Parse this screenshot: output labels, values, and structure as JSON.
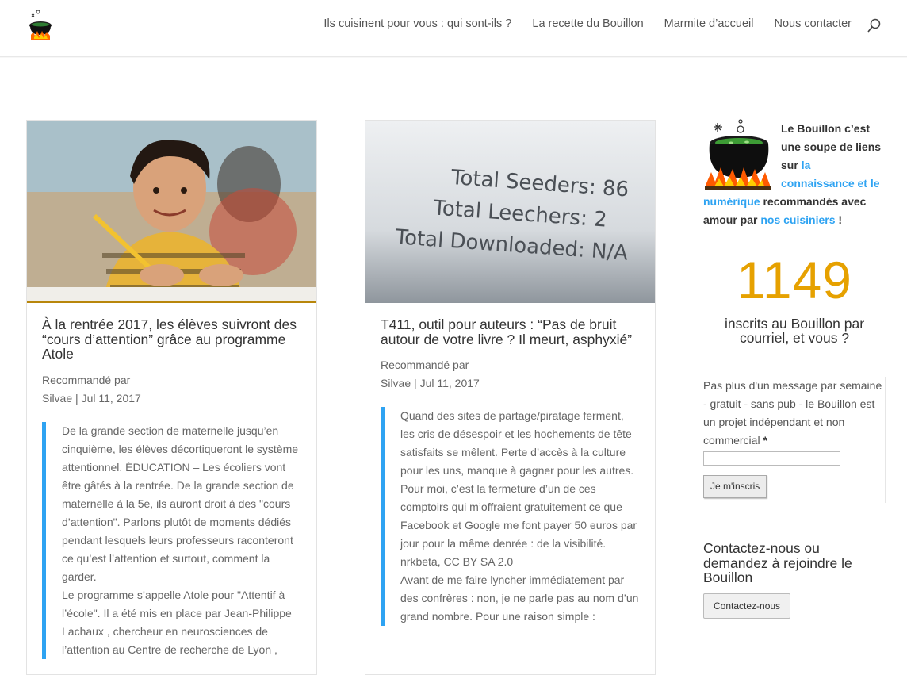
{
  "nav": {
    "items": [
      "Ils cuisinent pour vous : qui sont-ils ?",
      "La recette du Bouillon",
      "Marmite d’accueil",
      "Nous contacter"
    ]
  },
  "posts": [
    {
      "title": "À la rentrée 2017, les élèves suivront des “cours d’attention” grâce au programme Atole",
      "recommended": "Recommandé par",
      "author": "Silvae",
      "separator": "|",
      "date": "Jul 11, 2017",
      "excerpt": [
        "De la grande section de maternelle jusqu’en cinquième, les élèves décortiqueront le système attentionnel. ÉDUCATION – Les écoliers vont être gâtés à la rentrée. De la grande section de maternelle à la 5e, ils auront droit à des \"cours d’attention\". Parlons plutôt de moments dédiés pendant lesquels leurs professeurs raconteront ce qu’est l’attention et surtout, comment la garder.",
        "Le programme s’appelle Atole pour \"Attentif à l’école\". Il a été mis en place par Jean-Philippe Lachaux , chercheur en neurosciences de l’attention au Centre de recherche de Lyon ,"
      ]
    },
    {
      "title": "T411, outil pour auteurs : “Pas de bruit autour de votre livre ? Il meurt, asphyxié”",
      "recommended": "Recommandé par",
      "author": "Silvae",
      "separator": "|",
      "date": "Jul 11, 2017",
      "image_text": [
        "Total Seeders: 86",
        "Total Leechers: 2",
        "Total Downloaded: N/A"
      ],
      "excerpt": [
        "Quand des sites de partage/piratage ferment, les cris de désespoir et les hochements de tête satisfaits se mêlent. Perte d’accès à la culture pour les uns, manque à gagner pour les autres. Pour moi, c’est la fermeture d’un de ces comptoirs qui m’offraient gratuitement ce que Facebook et Google me font payer 50 euros par jour pour la même denrée : de la visibilité.",
        "nrkbeta, CC BY SA 2.0",
        "Avant de me faire lyncher immédiatement par des confrères : non, je ne parle pas au nom d’un grand nombre. Pour une raison simple :"
      ]
    }
  ],
  "sidebar": {
    "intro_1": "Le Bouillon c’est une soupe de liens sur ",
    "intro_link1": "la connaissance et le numérique",
    "intro_2": " recommandés avec amour par ",
    "intro_link2": "nos cuisiniers",
    "intro_3": " !",
    "subscriber_count": "1149",
    "subscriber_label": "inscrits au Bouillon par courriel, et vous ?",
    "form_text": "Pas plus d'un message par semaine - gratuit - sans pub - le Bouillon est un projet indépendant et non commercial",
    "required_mark": "*",
    "subscribe_button": "Je m'inscris",
    "contact_title": "Contactez-nous ou demandez à rejoindre le Bouillon",
    "contact_button": "Contactez-nous"
  },
  "colors": {
    "accent": "#2ea3f2",
    "counter": "#e6a100"
  },
  "icons": {
    "search": "search-icon",
    "logo": "cauldron-logo"
  }
}
